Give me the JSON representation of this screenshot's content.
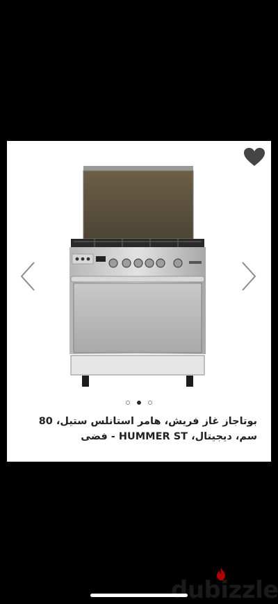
{
  "listing": {
    "title": "بوتاجاز غاز فريش، هامر استانلس ستيل، 80 سم، ديجيتال، HUMMER ST - فضى",
    "gallery": {
      "current_index": 2,
      "total_images": 3
    },
    "favorite_icon": "heart-icon",
    "prev_icon": "chevron-left-icon",
    "next_icon": "chevron-right-icon",
    "colors": {
      "background": "#000000",
      "card": "#ffffff",
      "heart": "#444444",
      "chevron": "#8c8c8c",
      "text": "#222222",
      "watermark_flame": "#b00000"
    }
  },
  "watermark": {
    "brand": "dubizzle"
  }
}
